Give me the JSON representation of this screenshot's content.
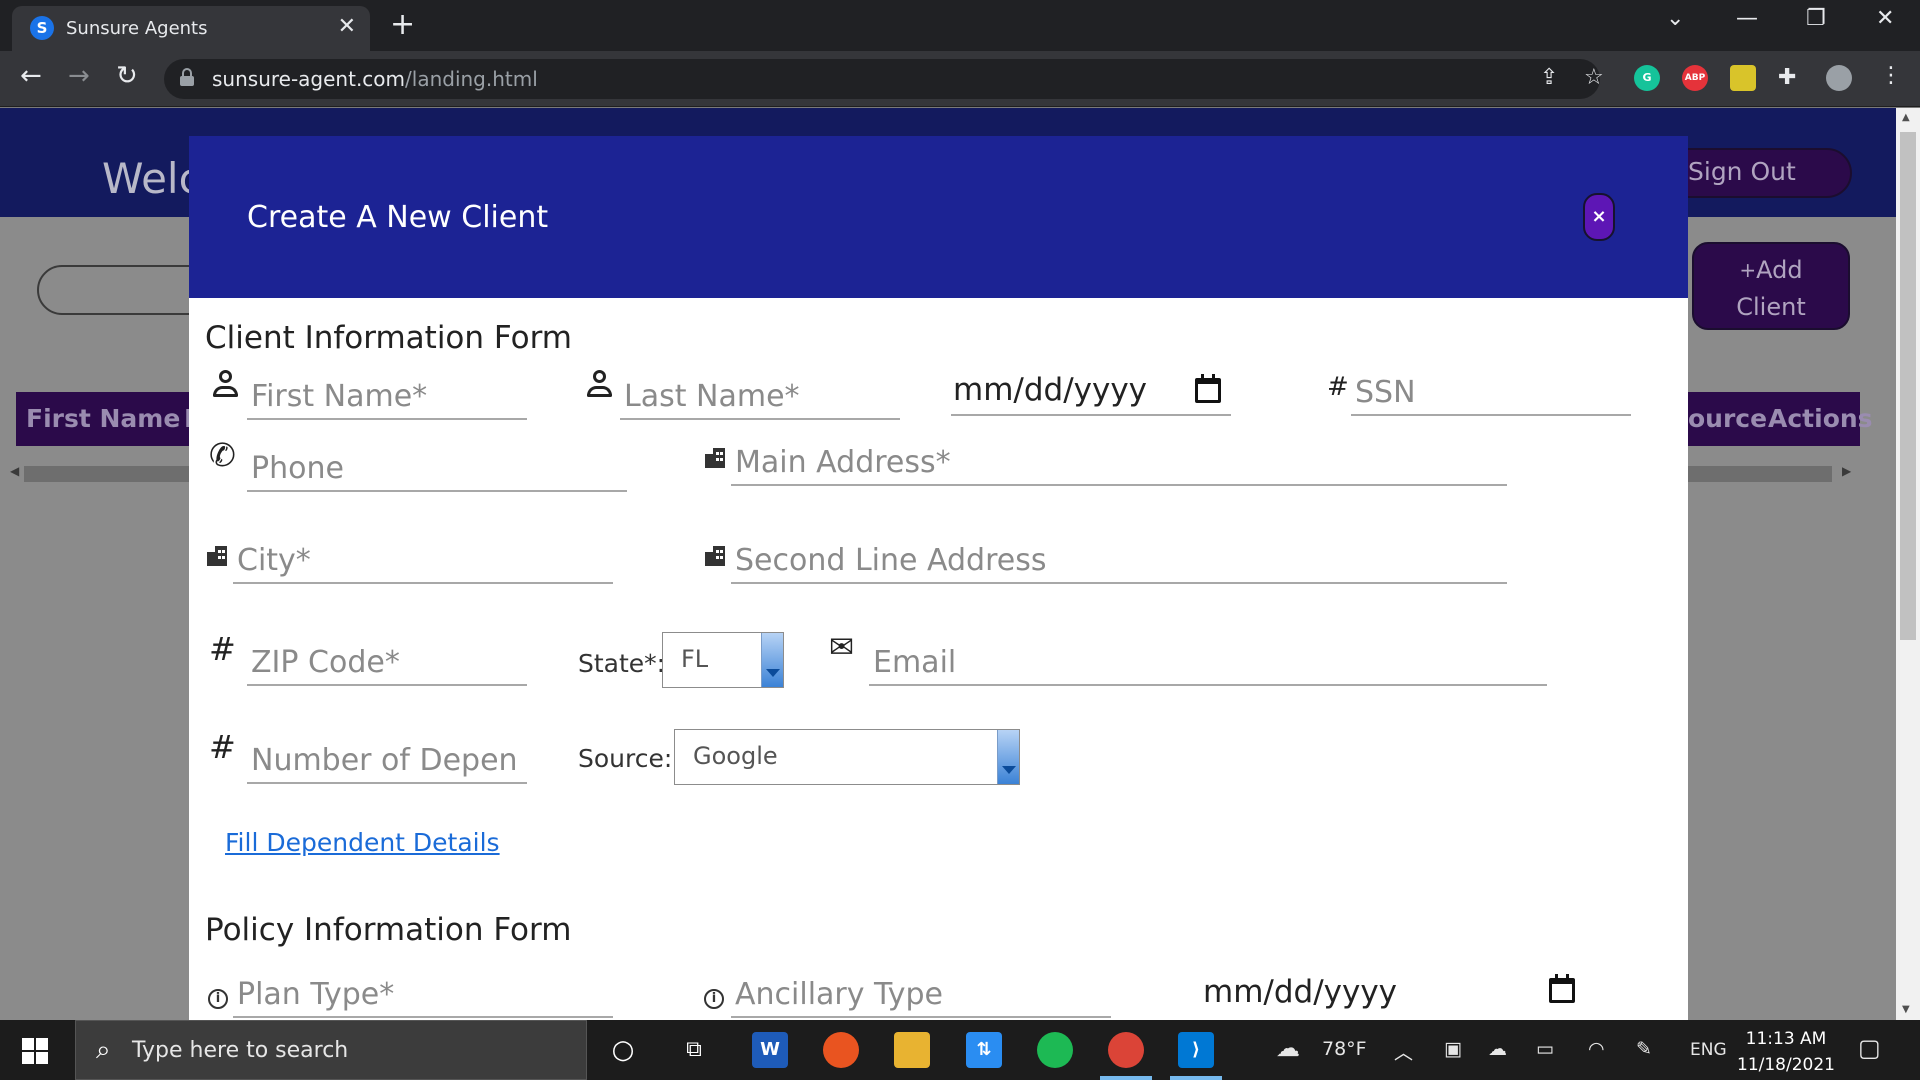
{
  "browser": {
    "tab_title": "Sunsure Agents",
    "tab_favicon_letter": "S",
    "url_host": "sunsure-agent.com",
    "url_path": "/landing.html"
  },
  "page": {
    "welcome_text": "Welc",
    "signout_label": "Sign Out",
    "add_client_plus": "+",
    "add_client_line1": "Add",
    "add_client_line2": "Client",
    "table_headers": [
      "First Name",
      "I",
      "ource",
      "Actions"
    ]
  },
  "modal": {
    "title": "Create A New Client",
    "close_label": "×",
    "client_section_title": "Client Information Form",
    "first_name_placeholder": "First Name*",
    "last_name_placeholder": "Last Name*",
    "dob_value": "mm/dd/yyyy",
    "ssn_placeholder": "SSN",
    "phone_placeholder": "Phone",
    "main_address_placeholder": "Main Address*",
    "city_placeholder": "City*",
    "second_address_placeholder": "Second Line Address",
    "zip_placeholder": "ZIP Code*",
    "state_label": "State*:",
    "state_value": "FL",
    "email_placeholder": "Email",
    "dependents_placeholder": "Number of Depen",
    "source_label": "Source:",
    "source_value": "Google",
    "fill_dependents_link": "Fill Dependent Details",
    "policy_section_title": "Policy Information Form",
    "plan_type_placeholder": "Plan Type*",
    "ancillary_type_placeholder": "Ancillary Type",
    "policy_date_value": "mm/dd/yyyy",
    "hash_symbol": "#",
    "info_symbol": "i"
  },
  "taskbar": {
    "search_placeholder": "Type here to search",
    "temperature": "78°F",
    "language": "ENG",
    "time": "11:13 AM",
    "date": "11/18/2021"
  },
  "colors": {
    "modal_header": "#1c2394",
    "close_button": "#5d16b5",
    "link": "#1a6bd8",
    "page_header": "#131a5e",
    "button_dark": "#2b0a4a"
  }
}
